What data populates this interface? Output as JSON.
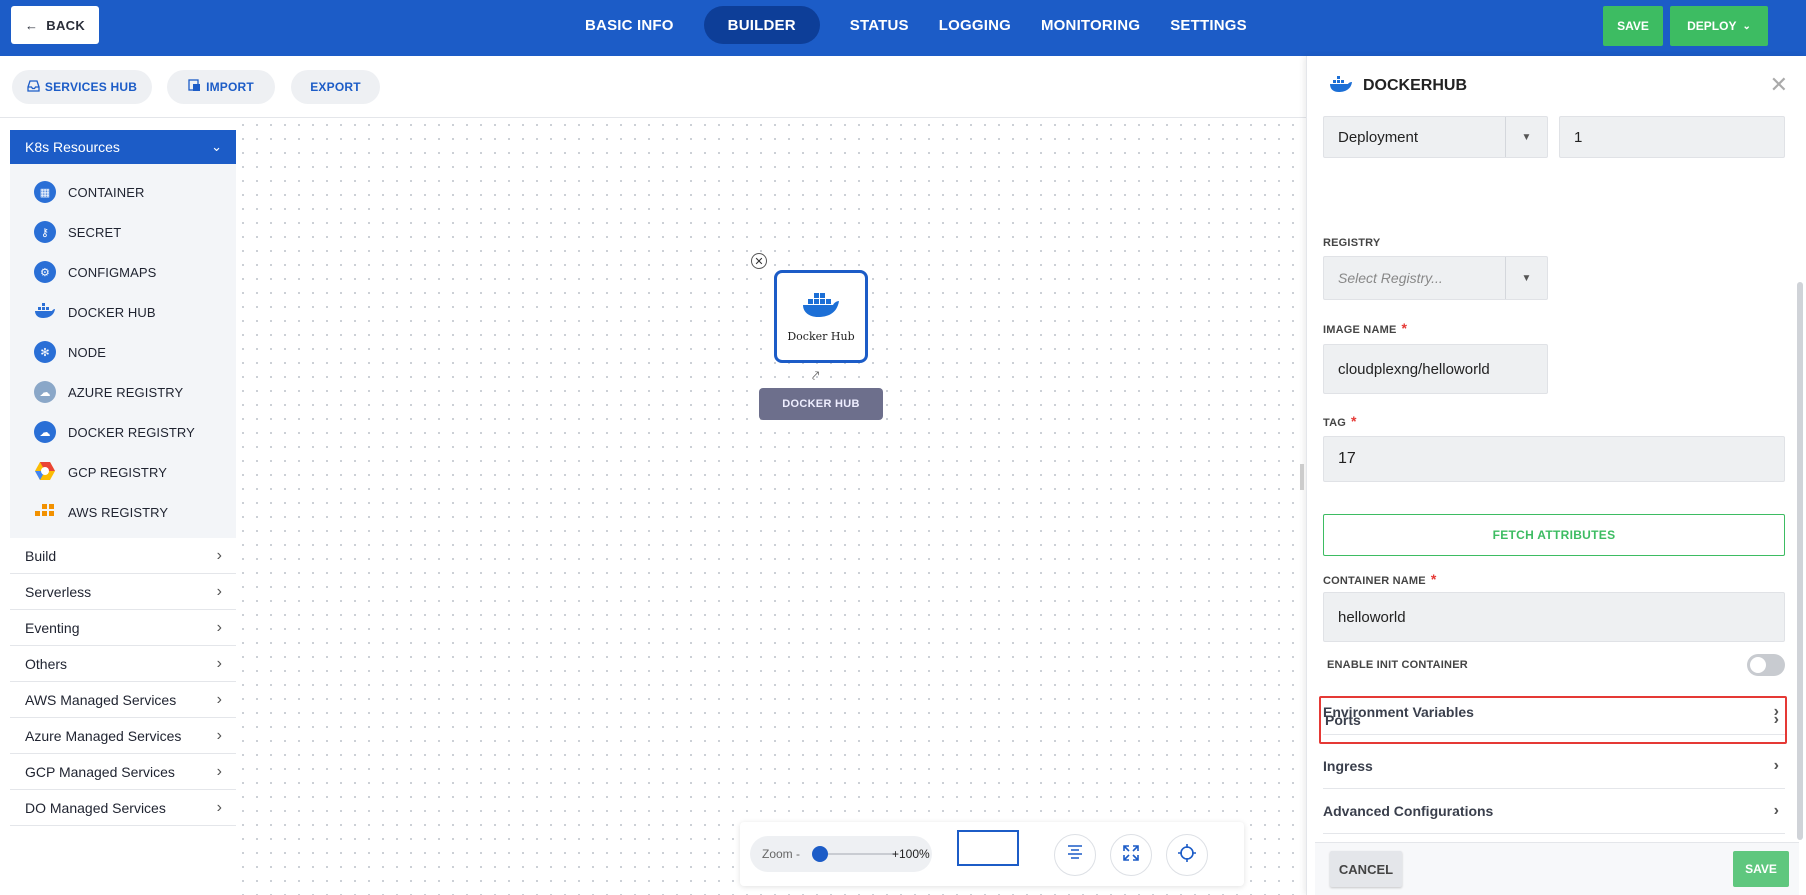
{
  "topbar": {
    "back_label": "BACK",
    "tabs": [
      {
        "label": "BASIC INFO",
        "active": false
      },
      {
        "label": "BUILDER",
        "active": true
      },
      {
        "label": "STATUS",
        "active": false
      },
      {
        "label": "LOGGING",
        "active": false
      },
      {
        "label": "MONITORING",
        "active": false
      },
      {
        "label": "SETTINGS",
        "active": false
      }
    ],
    "save_label": "SAVE",
    "deploy_label": "DEPLOY"
  },
  "subbar": {
    "services_hub_label": "SERVICES HUB",
    "import_label": "IMPORT",
    "export_label": "EXPORT"
  },
  "sidebar": {
    "k8s_header": "K8s Resources",
    "k8s_items": [
      {
        "label": "CONTAINER",
        "icon": "container-icon"
      },
      {
        "label": "SECRET",
        "icon": "secret-icon"
      },
      {
        "label": "CONFIGMAPS",
        "icon": "configmaps-icon"
      },
      {
        "label": "DOCKER HUB",
        "icon": "docker-hub-icon"
      },
      {
        "label": "NODE",
        "icon": "node-icon"
      },
      {
        "label": "AZURE REGISTRY",
        "icon": "azure-registry-icon"
      },
      {
        "label": "DOCKER REGISTRY",
        "icon": "docker-registry-icon"
      },
      {
        "label": "GCP REGISTRY",
        "icon": "gcp-registry-icon"
      },
      {
        "label": "AWS REGISTRY",
        "icon": "aws-registry-icon"
      }
    ],
    "categories": [
      "Build",
      "Serverless",
      "Eventing",
      "Others",
      "AWS Managed Services",
      "Azure Managed Services",
      "GCP Managed Services",
      "DO Managed Services"
    ]
  },
  "canvas": {
    "node_label": "Docker Hub",
    "node_tag": "DOCKER HUB"
  },
  "toolbar": {
    "zoom_label": "Zoom -",
    "zoom_value": "+100%",
    "zoom_level": 1.0
  },
  "panel": {
    "title": "DOCKERHUB",
    "kind_value": "Deployment",
    "replicas_value": "1",
    "registry_label": "REGISTRY",
    "registry_placeholder": "Select Registry...",
    "image_name_label": "IMAGE NAME",
    "image_name_value": "cloudplexng/helloworld",
    "tag_label": "TAG",
    "tag_value": "17",
    "fetch_label": "FETCH ATTRIBUTES",
    "container_name_label": "CONTAINER NAME",
    "container_name_value": "helloworld",
    "init_container_label": "ENABLE INIT CONTAINER",
    "init_container_enabled": false,
    "sections": [
      {
        "label": "Environment Variables",
        "highlighted": false
      },
      {
        "label": "Ports",
        "highlighted": true
      },
      {
        "label": "Ingress",
        "highlighted": false
      },
      {
        "label": "Advanced Configurations",
        "highlighted": false
      }
    ],
    "cancel_label": "CANCEL",
    "save_label": "SAVE"
  },
  "colors": {
    "primary": "#1c5cc7",
    "success": "#3dbc62",
    "highlight": "#e53935"
  }
}
